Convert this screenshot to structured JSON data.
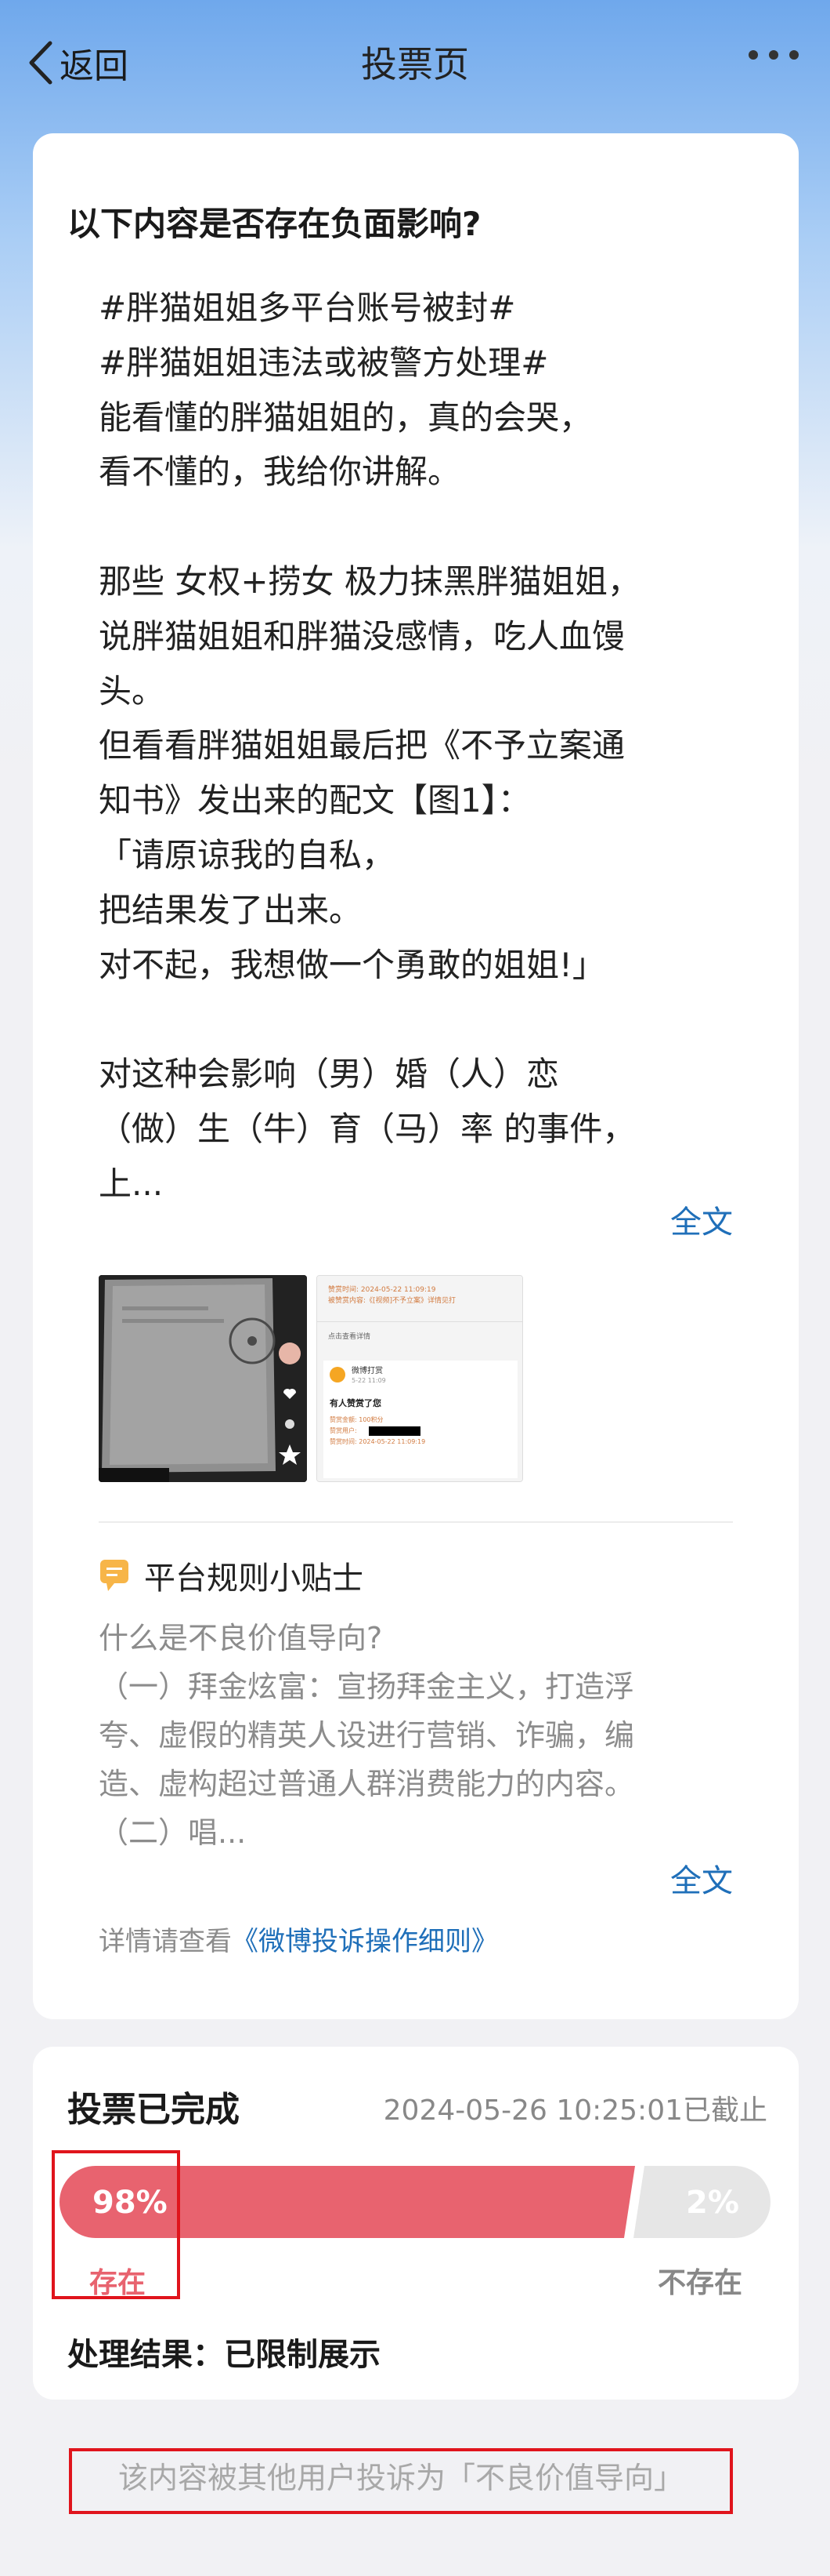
{
  "nav": {
    "back_label": "返回",
    "title": "投票页"
  },
  "question": "以下内容是否存在负面影响?",
  "post_lines": [
    "#胖猫姐姐多平台账号被封#",
    "#胖猫姐姐违法或被警方处理#",
    "能看懂的胖猫姐姐的，真的会哭，",
    "看不懂的，我给你讲解。",
    "",
    "那些 女权+捞女 极力抹黑胖猫姐姐，",
    "说胖猫姐姐和胖猫没感情，吃人血馒",
    "头。",
    "但看看胖猫姐姐最后把《不予立案通",
    "知书》发出来的配文【图1】：",
    "「请原谅我的自私，",
    "把结果发了出来。",
    "对不起，我想做一个勇敢的姐姐!」",
    "",
    "对这种会影响（男）婚（人）恋",
    "（做）生（牛）育（马）率 的事件，",
    "上..."
  ],
  "fulltext_label": "全文",
  "thumb2": {
    "line1": "赞赏时间: 2024-05-22 11:09:19",
    "line2": "被赞赏内容:《[视频]不予立案》详情见打",
    "line3": "点击查看详情",
    "name": "微博打赏",
    "date": "5-22 11:09",
    "msg": "有人赞赏了您",
    "amt": "赞赏金额: 100积分",
    "who": "赞赏用户:",
    "time": "赞赏时间: 2024-05-22 11:09:19"
  },
  "tips": {
    "title": "平台规则小贴士",
    "lines": [
      "什么是不良价值导向?",
      "（一）拜金炫富：宣扬拜金主义，打造浮",
      "夸、虚假的精英人设进行营销、诈骗，编",
      "造、虚构超过普通人群消费能力的内容。",
      "（二）唱..."
    ]
  },
  "detail": {
    "prefix": "详情请查看",
    "link": "《微博投诉操作细则》"
  },
  "vote": {
    "title": "投票已完成",
    "time": "2024-05-26 10:25:01已截止",
    "options": [
      {
        "label": "存在",
        "percent_text": "98%",
        "share": 0.98,
        "color": "#e8636f"
      },
      {
        "label": "不存在",
        "percent_text": "2%",
        "share": 0.02,
        "color": "#e6e6e6"
      }
    ],
    "result_label": "处理结果：",
    "result_value": "已限制展示"
  },
  "footer": "该内容被其他用户投诉为「不良价值导向」",
  "colors": {
    "accent_blue": "#1f6fb9",
    "vote_red": "#e8636f",
    "highlight_red": "#e0141c"
  }
}
